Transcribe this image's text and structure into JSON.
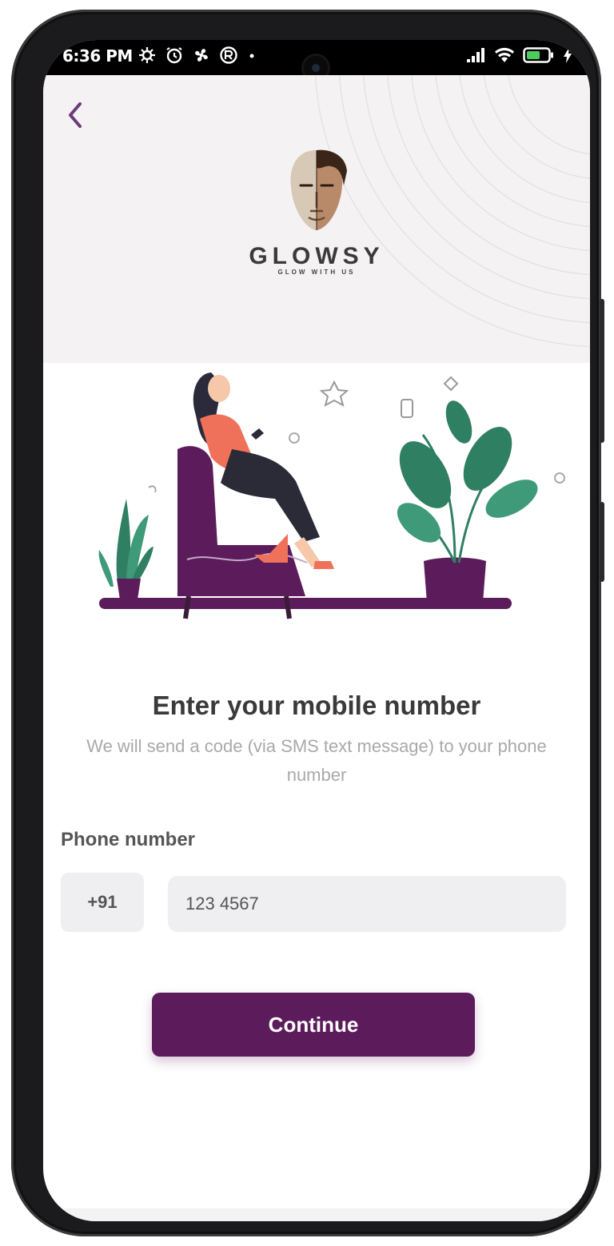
{
  "status_bar": {
    "time": "6:36 PM",
    "left_icons": [
      "settings-icon",
      "alarm-icon",
      "fan-icon",
      "vpn-icon",
      "dot-icon"
    ],
    "right_icons": [
      "signal-icon",
      "wifi-icon",
      "battery-icon",
      "charging-icon"
    ]
  },
  "header": {
    "back_icon": "chevron-left-icon",
    "brand_name": "GLOWSY",
    "brand_tagline": "GLOW WITH US"
  },
  "main": {
    "title": "Enter your mobile number",
    "subtitle": "We will send a code (via SMS text message) to your phone number",
    "phone_label": "Phone number",
    "country_code": "+91",
    "phone_value": "123 4567",
    "continue_label": "Continue"
  },
  "colors": {
    "accent": "#5c1c5b",
    "plant_green": "#2f7f63",
    "jacket": "#f0715a",
    "field_bg": "#efeef0"
  }
}
